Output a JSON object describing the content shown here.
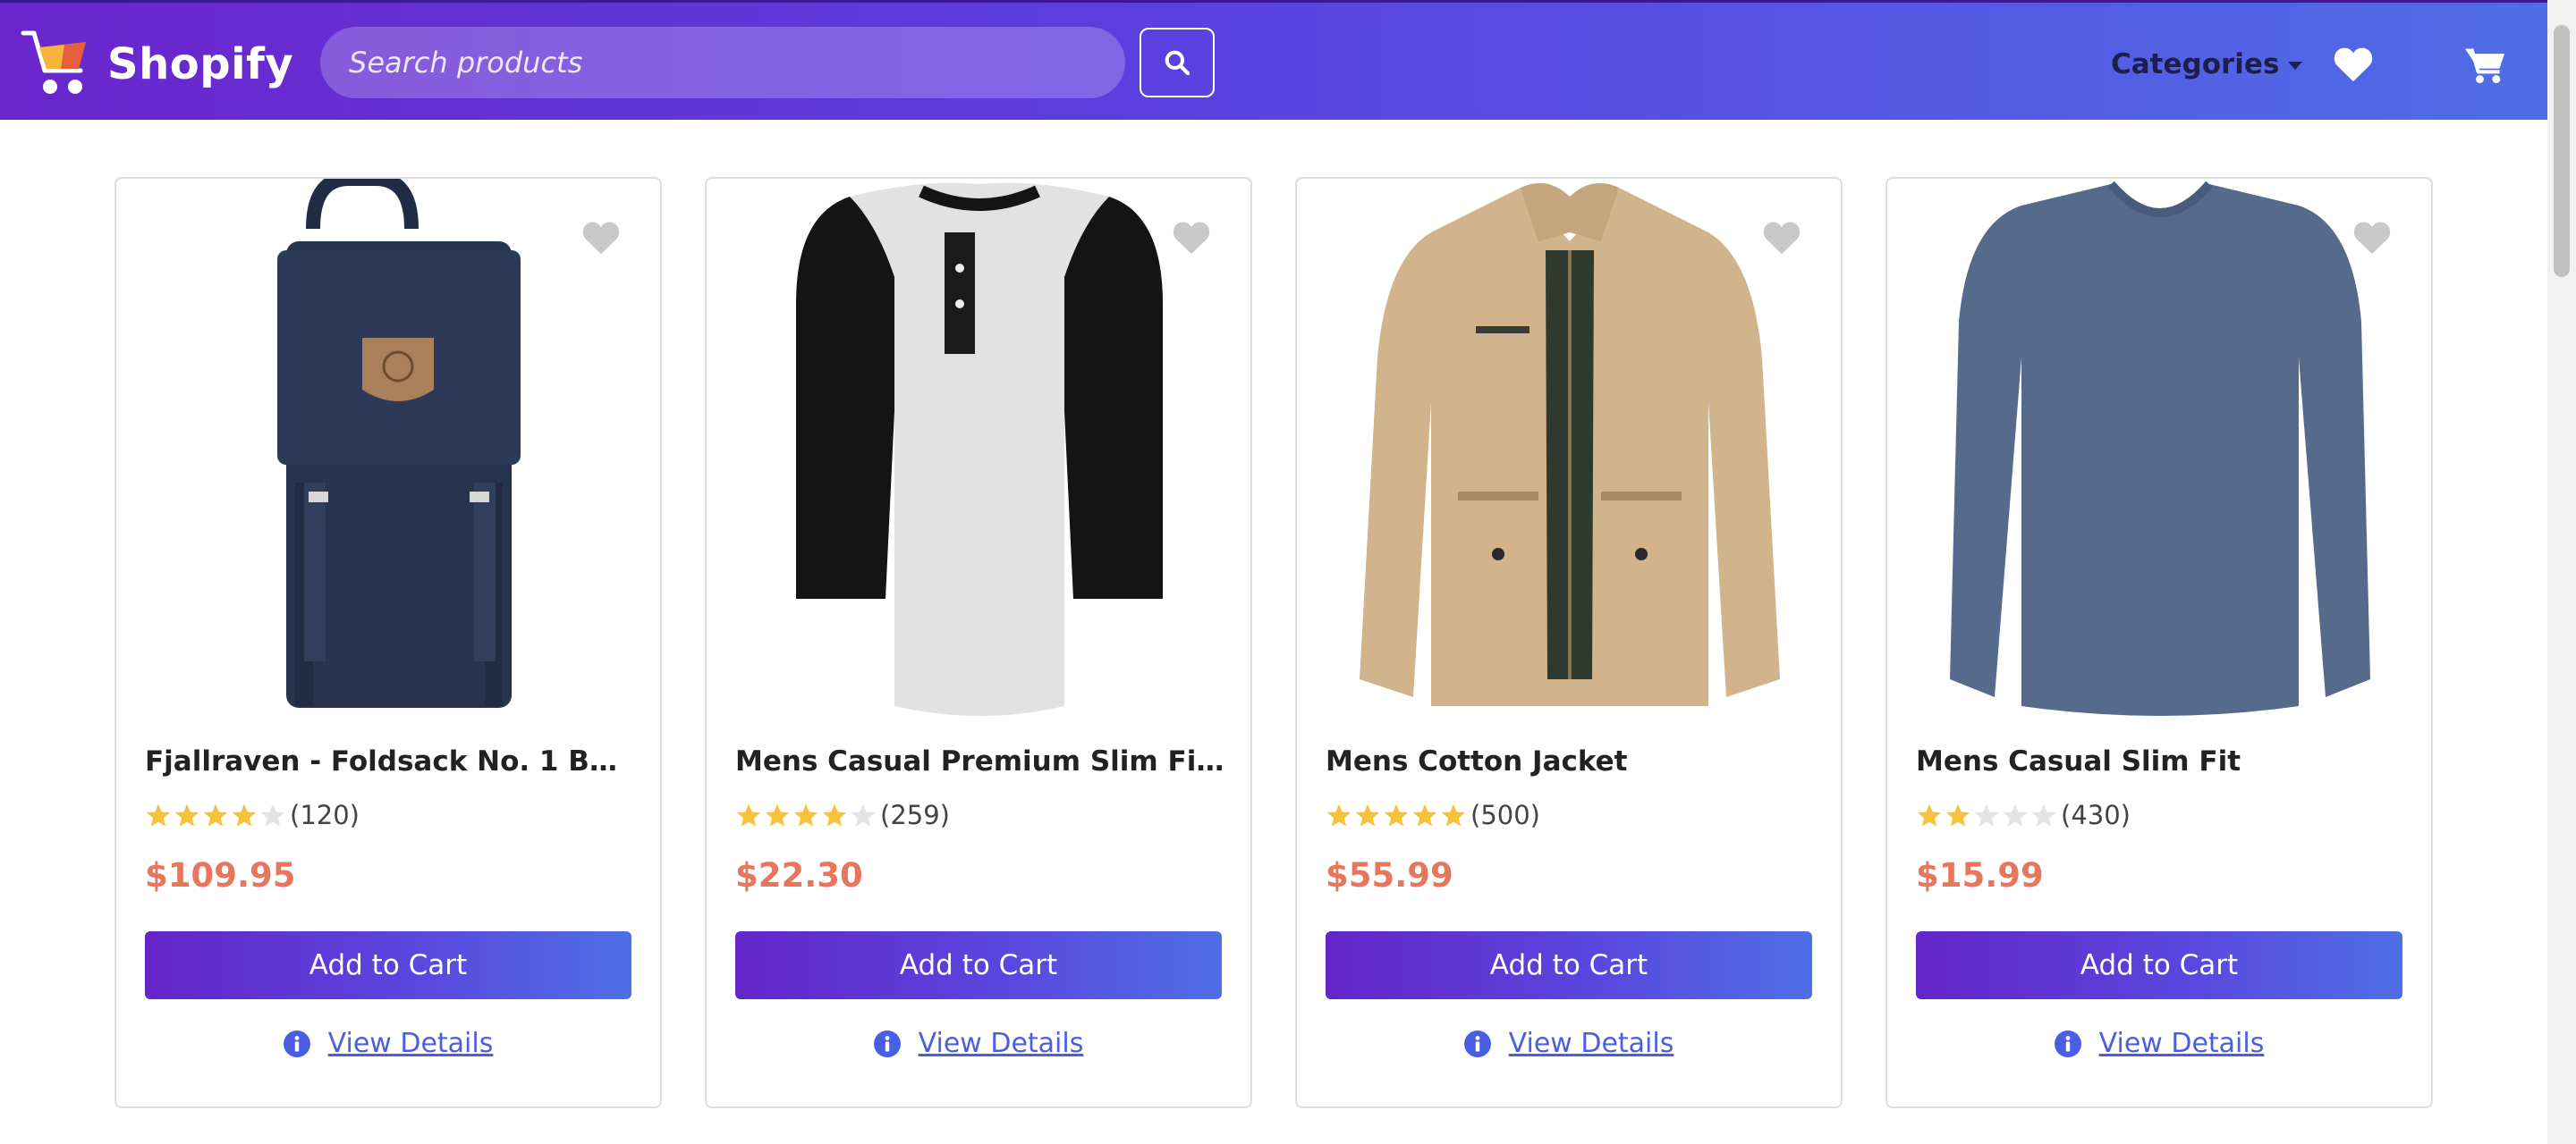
{
  "header": {
    "brand": "Shopify",
    "search_placeholder": "Search products",
    "categories_label": "Categories"
  },
  "colors": {
    "header_gradient_start": "#6a26cd",
    "header_gradient_end": "#4f6de6",
    "price": "#e8765c",
    "star_filled": "#f5c23c",
    "star_empty": "#e3e3e3",
    "link": "#4a5ee4"
  },
  "products": [
    {
      "title": "Fjallraven - Foldsack No. 1 Backpa...",
      "rating": 4,
      "rating_count": "(120)",
      "price": "$109.95",
      "add_to_cart": "Add to Cart",
      "view_details": "View Details",
      "image": "backpack-image"
    },
    {
      "title": "Mens Casual Premium Slim Fit T-S...",
      "rating": 4,
      "rating_count": "(259)",
      "price": "$22.30",
      "add_to_cart": "Add to Cart",
      "view_details": "View Details",
      "image": "raglan-tshirt-image"
    },
    {
      "title": "Mens Cotton Jacket",
      "rating": 5,
      "rating_count": "(500)",
      "price": "$55.99",
      "add_to_cart": "Add to Cart",
      "view_details": "View Details",
      "image": "cotton-jacket-image"
    },
    {
      "title": "Mens Casual Slim Fit",
      "rating": 2,
      "rating_count": "(430)",
      "price": "$15.99",
      "add_to_cart": "Add to Cart",
      "view_details": "View Details",
      "image": "longsleeve-shirt-image"
    }
  ]
}
